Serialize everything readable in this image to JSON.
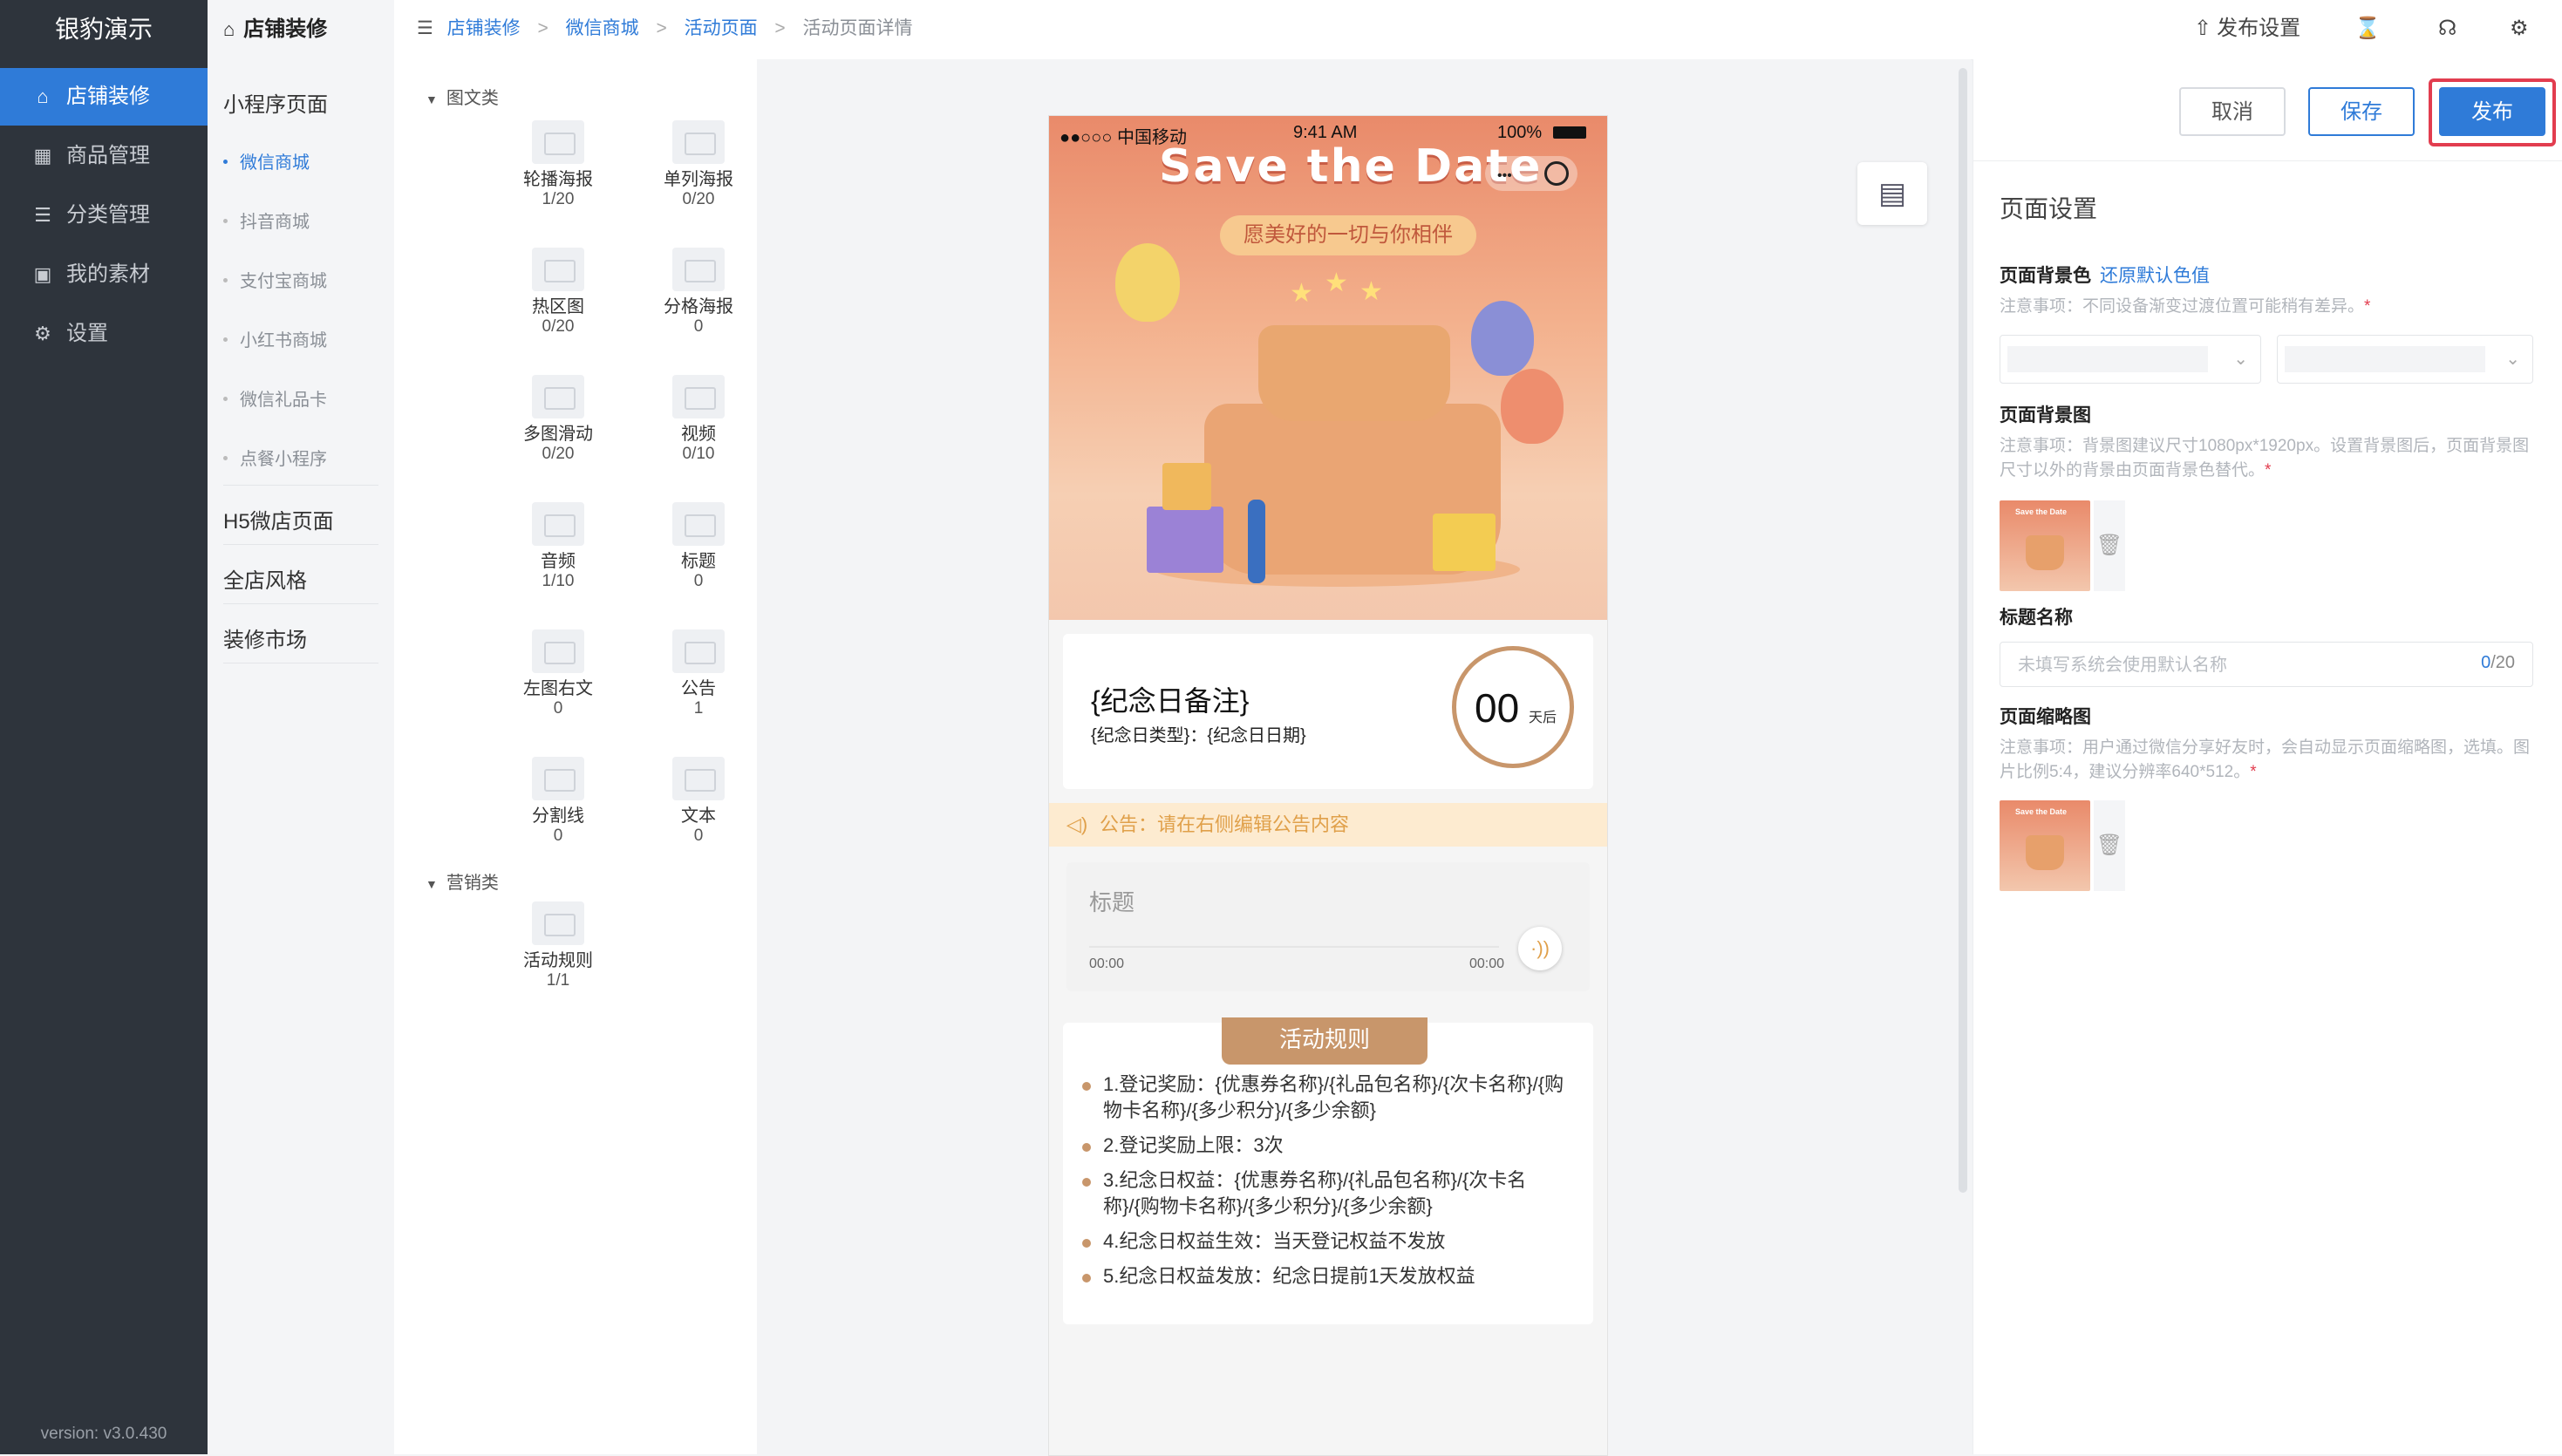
{
  "sidebar": {
    "brand": "银豹演示",
    "items": [
      {
        "label": "店铺装修",
        "icon": "shop-icon"
      },
      {
        "label": "商品管理",
        "icon": "grid-icon"
      },
      {
        "label": "分类管理",
        "icon": "list-icon"
      },
      {
        "label": "我的素材",
        "icon": "image-icon"
      },
      {
        "label": "设置",
        "icon": "gear-icon"
      }
    ],
    "version": "version: v3.0.430"
  },
  "nav2": {
    "title": "店铺装修",
    "group1": "小程序页面",
    "subs": [
      "微信商城",
      "抖音商城",
      "支付宝商城",
      "小红书商城",
      "微信礼品卡",
      "点餐小程序"
    ],
    "group2": "H5微店页面",
    "group3": "全店风格",
    "group4": "装修市场"
  },
  "breadcrumb": {
    "c1": "店铺装修",
    "c2": "微信商城",
    "c3": "活动页面",
    "c4": "活动页面详情",
    "sep": ">"
  },
  "topbar": {
    "publish_settings": "发布设置"
  },
  "library": {
    "cat1": "图文类",
    "widgets": [
      {
        "name": "轮播海报",
        "count": "1/20"
      },
      {
        "name": "单列海报",
        "count": "0/20"
      },
      {
        "name": "热区图",
        "count": "0/20"
      },
      {
        "name": "分格海报",
        "count": "0"
      },
      {
        "name": "多图滑动",
        "count": "0/20"
      },
      {
        "name": "视频",
        "count": "0/10"
      },
      {
        "name": "音频",
        "count": "1/10"
      },
      {
        "name": "标题",
        "count": "0"
      },
      {
        "name": "左图右文",
        "count": "0"
      },
      {
        "name": "公告",
        "count": "1"
      },
      {
        "name": "分割线",
        "count": "0"
      },
      {
        "name": "文本",
        "count": "0"
      }
    ],
    "cat2": "营销类",
    "marketing": [
      {
        "name": "活动规则",
        "count": "1/1"
      }
    ]
  },
  "phone": {
    "status": {
      "carrier": "●●○○○ 中国移动",
      "time": "9:41 AM",
      "battery": "100%"
    },
    "poster_title": "Save the Date",
    "ribbon": "愿美好的一切与你相伴",
    "countdown": {
      "title": "{纪念日备注}",
      "subtitle": "{纪念日类型}：{纪念日日期}",
      "number": "00",
      "unit": "天后"
    },
    "notice": "公告：请在右侧编辑公告内容",
    "audio": {
      "title": "标题",
      "start": "00:00",
      "end": "00:00"
    },
    "rules": {
      "tag": "活动规则",
      "items": [
        "1.登记奖励：{优惠券名称}/{礼品包名称}/{次卡名称}/{购物卡名称}/{多少积分}/{多少余额}",
        "2.登记奖励上限：3次",
        "3.纪念日权益：{优惠券名称}/{礼品包名称}/{次卡名称}/{购物卡名称}/{多少积分}/{多少余额}",
        "4.纪念日权益生效：当天登记权益不发放",
        "5.纪念日权益发放：纪念日提前1天发放权益"
      ]
    }
  },
  "right": {
    "cancel": "取消",
    "save": "保存",
    "publish": "发布",
    "heading": "页面设置",
    "bg_color_label": "页面背景色",
    "bg_color_reset": "还原默认色值",
    "bg_color_note": "注意事项：不同设备渐变过渡位置可能稍有差异。",
    "required": "*",
    "bg_image_label": "页面背景图",
    "bg_image_note": "注意事项：背景图建议尺寸1080px*1920px。设置背景图后，页面背景图尺寸以外的背景由页面背景色替代。",
    "title_label": "标题名称",
    "title_placeholder": "未填写系统会使用默认名称",
    "title_count": "0",
    "title_max": "/20",
    "thumb_label": "页面缩略图",
    "thumb_note": "注意事项：用户通过微信分享好友时，会自动显示页面缩略图，选填。图片比例5:4，建议分辨率640*512。",
    "thumb_text": "Save the Date"
  },
  "colors": {
    "accent": "#2f7bd8",
    "highlight": "#e23d4f",
    "sidebar": "#2e343c",
    "gold": "#c8966b"
  }
}
